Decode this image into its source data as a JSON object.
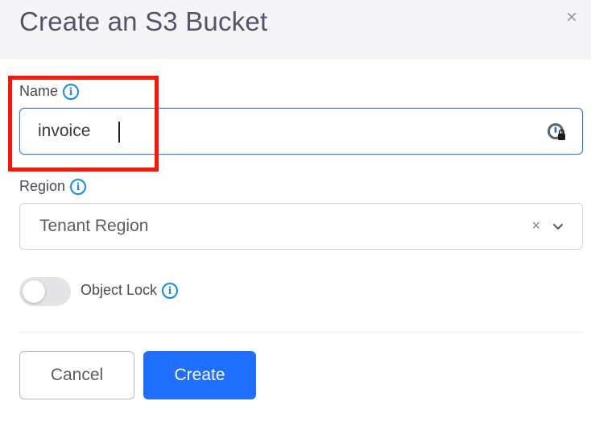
{
  "dialog": {
    "title": "Create an S3 Bucket",
    "close_label": "×"
  },
  "fields": {
    "name": {
      "label": "Name",
      "value": "invoice",
      "icon": "password-manager-icon"
    },
    "region": {
      "label": "Region",
      "selected": "Tenant Region",
      "clear_label": "×"
    },
    "object_lock": {
      "label": "Object Lock",
      "enabled": false
    }
  },
  "buttons": {
    "cancel": "Cancel",
    "create": "Create"
  },
  "colors": {
    "header_bg": "#f5f5f7",
    "primary": "#1f6fff",
    "focus_border": "#3b7be0",
    "info": "#1d8ad9",
    "highlight": "#f3190b"
  }
}
